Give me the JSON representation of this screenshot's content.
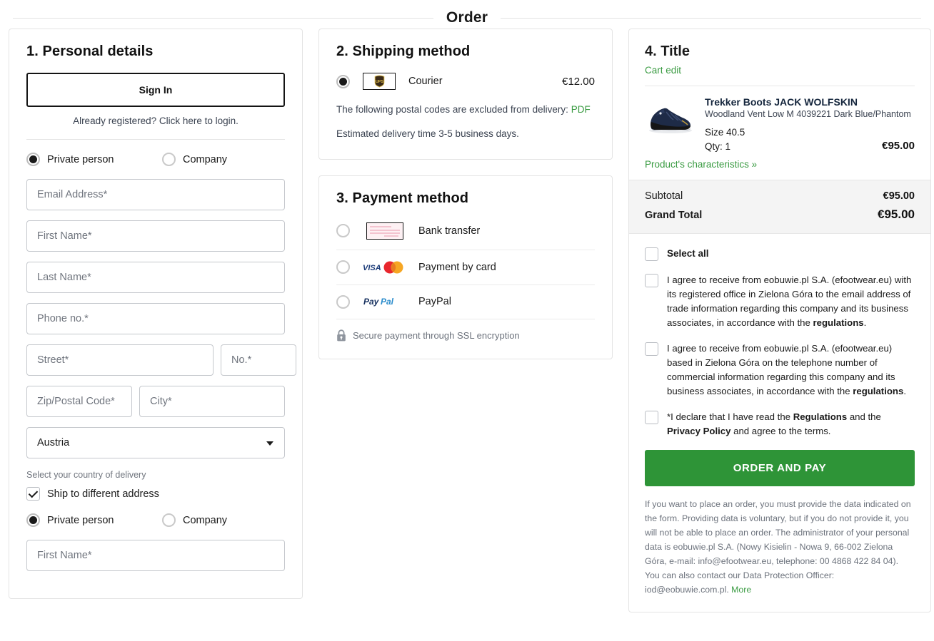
{
  "header": {
    "title": "Order"
  },
  "personal": {
    "title": "1. Personal details",
    "sign_in_label": "Sign In",
    "login_hint": "Already registered? Click here to login.",
    "customer_type": {
      "private_label": "Private person",
      "company_label": "Company",
      "selected": "Private person"
    },
    "fields": [
      {
        "name": "email",
        "placeholder": "Email Address*",
        "value": ""
      },
      {
        "name": "first-name",
        "placeholder": "First Name*",
        "value": ""
      },
      {
        "name": "last-name",
        "placeholder": "Last Name*",
        "value": ""
      },
      {
        "name": "phone",
        "placeholder": "Phone no.*",
        "value": ""
      }
    ],
    "street_placeholder": "Street*",
    "no_placeholder": "No.*",
    "zip_placeholder": "Zip/Postal Code*",
    "city_placeholder": "City*",
    "country_value": "Austria",
    "country_help": "Select your country of delivery",
    "ship_different_label": "Ship to different address",
    "ship_different_checked": true,
    "delivery_type": {
      "private_label": "Private person",
      "company_label": "Company",
      "selected": "Private person"
    },
    "delivery_first_name_placeholder": "First Name*"
  },
  "shipping": {
    "title": "2. Shipping method",
    "option": {
      "carrier_icon": "ups-logo",
      "label": "Courier",
      "price": "€12.00",
      "selected": true
    },
    "excluded_note": "The following postal codes are excluded from delivery:",
    "excluded_link": "PDF",
    "delivery_time": "Estimated delivery time 3-5 business days."
  },
  "payment": {
    "title": "3. Payment method",
    "options": [
      {
        "label": "Bank transfer",
        "icon": "bank-transfer-icon",
        "selected": false
      },
      {
        "label": "Payment by card",
        "icon": "visa-mastercard-icon",
        "selected": false
      },
      {
        "label": "PayPal",
        "icon": "paypal-icon",
        "selected": false
      }
    ],
    "ssl_note": "Secure payment through SSL encryption"
  },
  "summary": {
    "title": "4. Title",
    "cart_edit": "Cart edit",
    "product": {
      "name": "Trekker Boots JACK WOLFSKIN",
      "description": "Woodland Vent Low M 4039221 Dark Blue/Phantom",
      "size": "Size 40.5",
      "qty": "Qty: 1",
      "price": "€95.00",
      "characteristics_link": "Product's characteristics »"
    },
    "totals": {
      "subtotal_label": "Subtotal",
      "subtotal_value": "€95.00",
      "grand_total_label": "Grand Total",
      "grand_total_value": "€95.00"
    },
    "select_all_label": "Select all",
    "consents": [
      {
        "text_before": "I agree to receive from eobuwie.pl S.A. (efootwear.eu) with its registered office in Zielona Góra to the email address of trade information regarding this company and its business associates, in accordance with the ",
        "bold": "regulations",
        "text_after": ".",
        "checked": false
      },
      {
        "text_before": "I agree to receive from eobuwie.pl S.A. (efootwear.eu) based in Zielona Góra on the telephone number of commercial information regarding this company and its business associates, in accordance with the ",
        "bold": "regulations",
        "text_after": ".",
        "checked": false
      }
    ],
    "declaration": {
      "part1": "*I declare that I have read the ",
      "bold1": "Regulations",
      "part2": " and the ",
      "bold2": "Privacy Policy",
      "part3": " and agree to the terms.",
      "checked": false
    },
    "order_button": "ORDER AND PAY",
    "legal_text": "If you want to place an order, you must provide the data indicated on the form. Providing data is voluntary, but if you do not provide it, you will not be able to place an order. The administrator of your personal data is eobuwie.pl S.A. (Nowy Kisielin - Nowa 9, 66-002 Zielona Góra, e-mail: info@efootwear.eu, telephone: 00 4868 422 84 04). You can also contact our Data Protection Officer: iod@eobuwie.com.pl. ",
    "legal_more": "More"
  },
  "colors": {
    "accent_green": "#3a9b42",
    "button_green": "#2e9437",
    "border": "#e4e4e4",
    "field_border": "#c4c7cc",
    "totals_bg": "#f4f4f4"
  }
}
